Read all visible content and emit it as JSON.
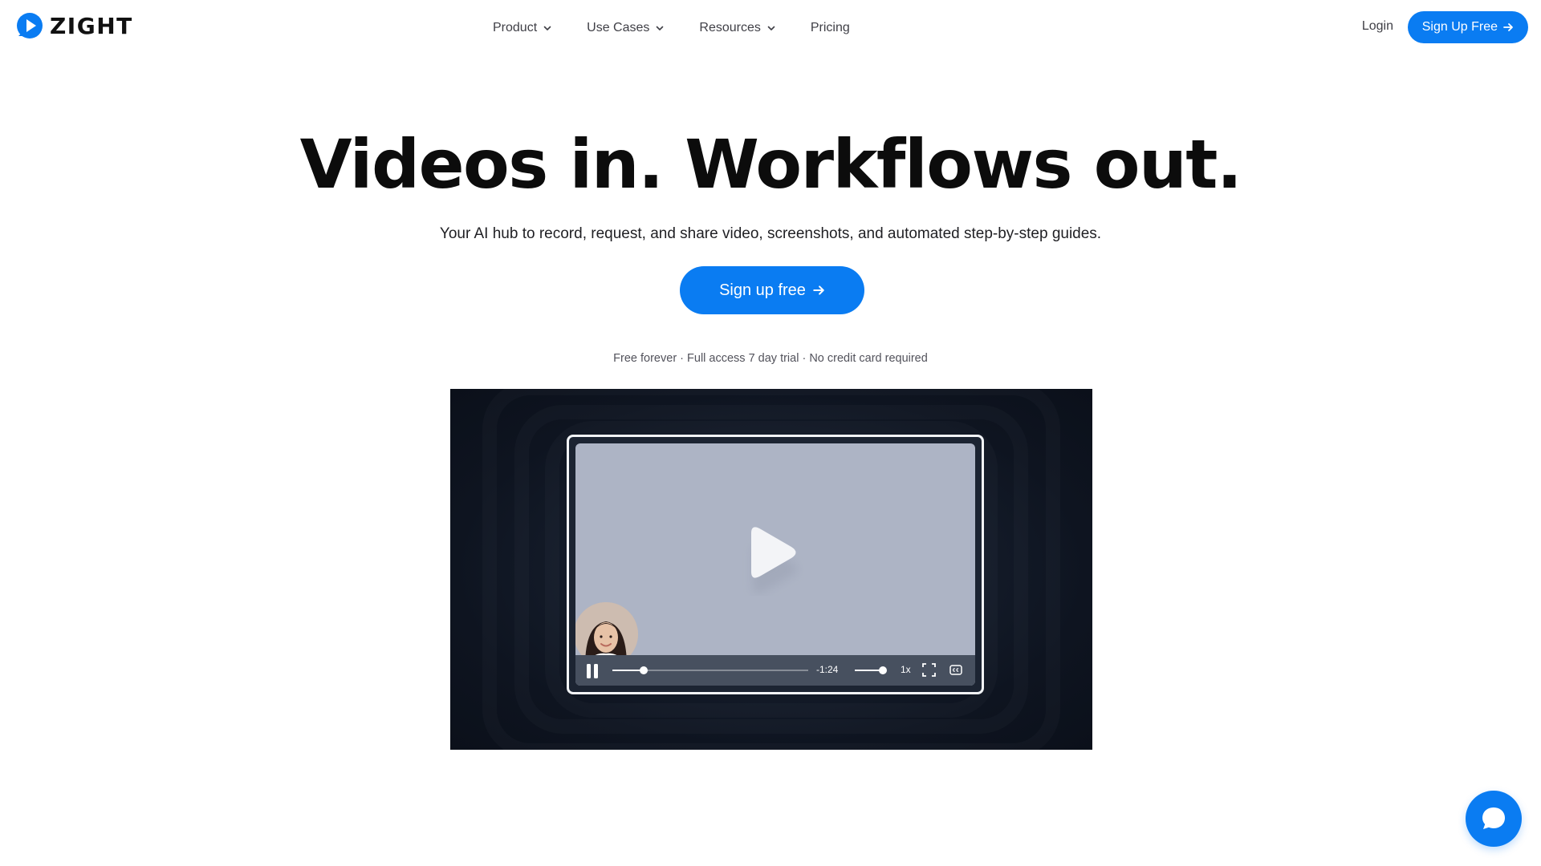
{
  "brand": {
    "name": "ZIGHT",
    "accent": "#0a7cf2"
  },
  "nav": {
    "items": [
      {
        "label": "Product",
        "has_dropdown": true
      },
      {
        "label": "Use Cases",
        "has_dropdown": true
      },
      {
        "label": "Resources",
        "has_dropdown": true
      },
      {
        "label": "Pricing",
        "has_dropdown": false
      }
    ],
    "login_label": "Login",
    "signup_label": "Sign Up Free"
  },
  "hero": {
    "title": "Videos in. Workflows out.",
    "subtitle": "Your AI hub to record, request, and share video, screenshots, and automated step-by-step guides.",
    "cta_label": "Sign up free",
    "fine_print": "Free forever · Full access 7 day trial · No credit card required"
  },
  "video": {
    "state": "paused",
    "progress": 0.16,
    "time_remaining": "-1:24",
    "volume": 0.9,
    "speed": "1x",
    "icons": [
      "play-icon",
      "pause-icon",
      "fullscreen-icon",
      "captions-icon"
    ]
  },
  "chat": {
    "icon": "chat-bubble-icon"
  }
}
